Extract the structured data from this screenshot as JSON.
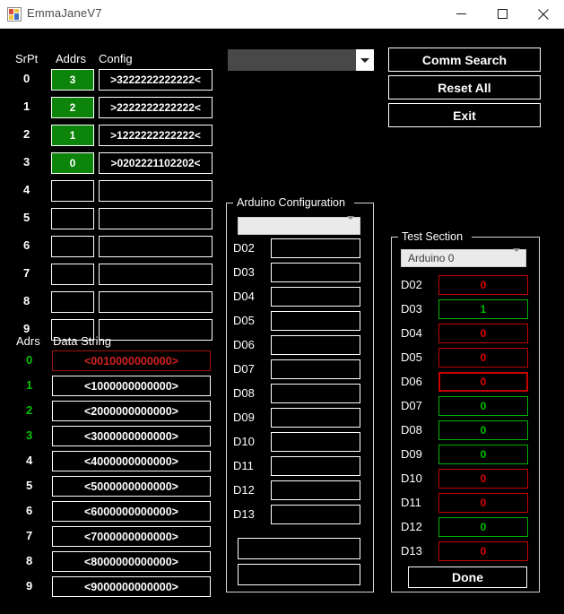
{
  "window": {
    "title": "EmmaJaneV7",
    "icon": "app-icon",
    "minimize_label": "—",
    "maximize_label": "☐",
    "close_label": "✕"
  },
  "serial_table": {
    "headers": {
      "srpt": "SrPt",
      "addrs": "Addrs",
      "config": "Config"
    },
    "rows": [
      {
        "srpt": "0",
        "addrs": "3",
        "addrs_active": true,
        "config": ">3222222222222<"
      },
      {
        "srpt": "1",
        "addrs": "2",
        "addrs_active": true,
        "config": ">2222222222222<"
      },
      {
        "srpt": "2",
        "addrs": "1",
        "addrs_active": true,
        "config": ">1222222222222<"
      },
      {
        "srpt": "3",
        "addrs": "0",
        "addrs_active": true,
        "config": ">0202221102202<"
      },
      {
        "srpt": "4",
        "addrs": "",
        "addrs_active": false,
        "config": ""
      },
      {
        "srpt": "5",
        "addrs": "",
        "addrs_active": false,
        "config": ""
      },
      {
        "srpt": "6",
        "addrs": "",
        "addrs_active": false,
        "config": ""
      },
      {
        "srpt": "7",
        "addrs": "",
        "addrs_active": false,
        "config": ""
      },
      {
        "srpt": "8",
        "addrs": "",
        "addrs_active": false,
        "config": ""
      },
      {
        "srpt": "9",
        "addrs": "",
        "addrs_active": false,
        "config": ""
      }
    ]
  },
  "data_table": {
    "headers": {
      "adrs": "Adrs",
      "data_string": "Data String"
    },
    "rows": [
      {
        "adrs": "0",
        "adrs_color": "green",
        "value": "<0010000000000>",
        "state": "selected"
      },
      {
        "adrs": "1",
        "adrs_color": "green",
        "value": "<1000000000000>",
        "state": "normal"
      },
      {
        "adrs": "2",
        "adrs_color": "green",
        "value": "<2000000000000>",
        "state": "normal"
      },
      {
        "adrs": "3",
        "adrs_color": "green",
        "value": "<3000000000000>",
        "state": "normal"
      },
      {
        "adrs": "4",
        "adrs_color": "white",
        "value": "<4000000000000>",
        "state": "normal"
      },
      {
        "adrs": "5",
        "adrs_color": "white",
        "value": "<5000000000000>",
        "state": "normal"
      },
      {
        "adrs": "6",
        "adrs_color": "white",
        "value": "<6000000000000>",
        "state": "normal"
      },
      {
        "adrs": "7",
        "adrs_color": "white",
        "value": "<7000000000000>",
        "state": "normal"
      },
      {
        "adrs": "8",
        "adrs_color": "white",
        "value": "<8000000000000>",
        "state": "normal"
      },
      {
        "adrs": "9",
        "adrs_color": "white",
        "value": "<9000000000000>",
        "state": "normal"
      }
    ]
  },
  "port_combo": {
    "value": "",
    "placeholder": ""
  },
  "buttons": {
    "comm_search": "Comm Search",
    "reset_all": "Reset All",
    "exit": "Exit",
    "done": "Done"
  },
  "arduino_config": {
    "title": "Arduino Configuration",
    "combo": {
      "value": "",
      "placeholder": ""
    },
    "pins": [
      {
        "label": "D02",
        "value": ""
      },
      {
        "label": "D03",
        "value": ""
      },
      {
        "label": "D04",
        "value": ""
      },
      {
        "label": "D05",
        "value": ""
      },
      {
        "label": "D06",
        "value": ""
      },
      {
        "label": "D07",
        "value": ""
      },
      {
        "label": "D08",
        "value": ""
      },
      {
        "label": "D09",
        "value": ""
      },
      {
        "label": "D10",
        "value": ""
      },
      {
        "label": "D11",
        "value": ""
      },
      {
        "label": "D12",
        "value": ""
      },
      {
        "label": "D13",
        "value": ""
      }
    ],
    "extra_fields": [
      {
        "value": ""
      },
      {
        "value": ""
      }
    ]
  },
  "test_section": {
    "title": "Test Section",
    "combo": {
      "value": "Arduino 0"
    },
    "pins": [
      {
        "label": "D02",
        "value": "0",
        "state": "off"
      },
      {
        "label": "D03",
        "value": "1",
        "state": "on"
      },
      {
        "label": "D04",
        "value": "0",
        "state": "off"
      },
      {
        "label": "D05",
        "value": "0",
        "state": "off"
      },
      {
        "label": "D06",
        "value": "0",
        "state": "off-focus"
      },
      {
        "label": "D07",
        "value": "0",
        "state": "on"
      },
      {
        "label": "D08",
        "value": "0",
        "state": "on"
      },
      {
        "label": "D09",
        "value": "0",
        "state": "on"
      },
      {
        "label": "D10",
        "value": "0",
        "state": "off"
      },
      {
        "label": "D11",
        "value": "0",
        "state": "off"
      },
      {
        "label": "D12",
        "value": "0",
        "state": "on"
      },
      {
        "label": "D13",
        "value": "0",
        "state": "off"
      }
    ]
  },
  "colors": {
    "background": "#000000",
    "foreground": "#ffffff",
    "active_green": "#0b8409",
    "value_green": "#00c000",
    "value_red": "#e00000",
    "titlebar": "#ffffff"
  }
}
